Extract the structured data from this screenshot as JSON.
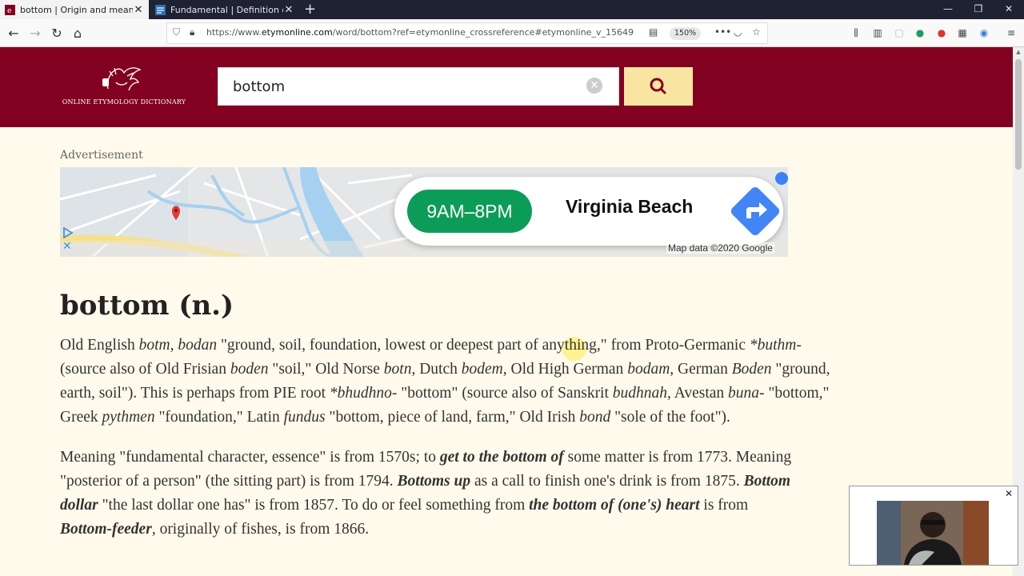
{
  "browser": {
    "tabs": [
      {
        "title": "bottom | Origin and meaning o",
        "active": true
      },
      {
        "title": "Fundamental | Definition of Fu",
        "active": false
      }
    ],
    "url": {
      "prefix": "https://www.",
      "host": "etymonline.com",
      "path": "/word/bottom?ref=etymonline_crossreference#etymonline_v_15649"
    },
    "zoom": "150%"
  },
  "site": {
    "logo_text": "ONLINE ETYMOLOGY DICTIONARY",
    "search_value": "bottom",
    "accent_color": "#820020",
    "search_button_color": "#f9e5a2"
  },
  "ad": {
    "label": "Advertisement",
    "hours": "9AM–8PM",
    "city": "Virginia Beach",
    "map_credit": "Map data ©2020 Google"
  },
  "entry": {
    "title": "bottom (n.)",
    "para1": [
      [
        "Old English ",
        "",
        "botm",
        "i",
        ", ",
        "",
        "bodan",
        "i",
        " \"ground, soil, foundation, lowest or deepest part of anything,\" from Proto-Germanic ",
        "",
        "*buthm-",
        "i"
      ],
      [
        "(source also of Old Frisian ",
        "",
        "boden",
        "i",
        " \"soil,\" Old Norse ",
        "",
        "botn",
        "i",
        ", Dutch ",
        "",
        "bodem",
        "i",
        ", Old High German ",
        "",
        "bodam",
        "i",
        ", German ",
        "",
        "Boden",
        "i",
        " \"ground,",
        ""
      ],
      [
        "earth, soil\"). This is perhaps from PIE root ",
        "",
        "*bhudhno-",
        "i",
        " \"bottom\" (source also of Sanskrit ",
        "",
        "budhnah",
        "i",
        ", Avestan ",
        "",
        "buna-",
        "i",
        " \"bottom,\"",
        ""
      ],
      [
        "Greek ",
        "",
        "pythmen",
        "i",
        " \"foundation,\" Latin ",
        "",
        "fundus",
        "i",
        " \"bottom, piece of land, farm,\" Old Irish ",
        "",
        "bond",
        "i",
        " \"sole of the foot\").",
        ""
      ]
    ],
    "para2": [
      [
        "Meaning \"fundamental character, essence\" is from 1570s; to ",
        "",
        "get to the bottom of",
        "bi",
        " some matter is from 1773. Meaning",
        ""
      ],
      [
        "\"posterior of a person\" (the sitting part) is from 1794. ",
        "",
        "Bottoms up",
        "bi",
        " as a call to finish one's drink is from 1875. ",
        "",
        "Bottom",
        "bi"
      ],
      [
        "dollar",
        "bi",
        " \"the last dollar one has\" is from 1857. To do or feel something from ",
        "",
        "the bottom of (one's) heart",
        "bi",
        " is from",
        ""
      ],
      [
        "Bottom-feeder",
        "bi",
        ", originally of fishes, is from 1866.",
        ""
      ]
    ]
  }
}
